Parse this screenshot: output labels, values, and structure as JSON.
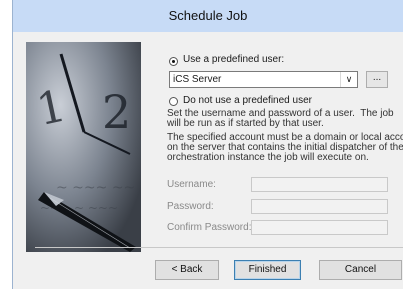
{
  "window": {
    "title": "Schedule Job"
  },
  "options": {
    "use_predefined_label": "Use a predefined user:",
    "use_predefined_selected": true,
    "user_select_value": "iCS Server",
    "browse_label": "...",
    "no_predefined_label": "Do not use a predefined user",
    "no_predefined_selected": false
  },
  "description": {
    "line1": "Set the username and password of a user.  The job",
    "line2": "will be run as if started by that user.",
    "line3": "The specified account must be a domain or local accoun",
    "line4": "on the server that contains the initial dispatcher of the",
    "line5": "orchestration instance the job will execute on."
  },
  "credentials": {
    "username_label": "Username:",
    "username_value": "",
    "password_label": "Password:",
    "password_value": "",
    "confirm_label": "Confirm Password:",
    "confirm_value": ""
  },
  "buttons": {
    "back": "< Back",
    "finished": "Finished",
    "cancel": "Cancel"
  },
  "colors": {
    "title_bar": "#c7dbf6",
    "dialog_bg": "#f0f0f0",
    "default_button_border": "#3c7fb1"
  },
  "icons": {
    "dropdown": "chevron-down-icon",
    "art": "clock-and-fountain-pen-image"
  }
}
